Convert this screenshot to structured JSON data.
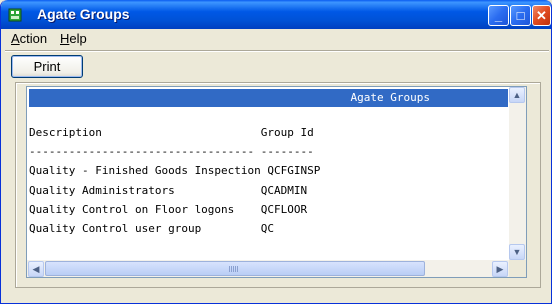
{
  "window": {
    "title": "Agate Groups"
  },
  "menu": {
    "action": "Action",
    "help": "Help"
  },
  "toolbar": {
    "print_label": "Print"
  },
  "report": {
    "header_title": "Agate Groups",
    "lines": [
      "Description                        Group Id",
      "---------------------------------- --------",
      "Quality - Finished Goods Inspection QCFGINSP",
      "Quality Administrators             QCADMIN",
      "Quality Control on Floor logons    QCFLOOR",
      "Quality Control user group         QC"
    ]
  },
  "scrollbars": {
    "horizontal_thumb_fraction": 0.83
  },
  "colors": {
    "titlebar": "#0058e6",
    "header_bar": "#316ac5",
    "face": "#ece9d8"
  },
  "icons": {
    "app": "app-icon",
    "minimize": "minimize-icon",
    "maximize": "maximize-icon",
    "close": "close-icon"
  }
}
